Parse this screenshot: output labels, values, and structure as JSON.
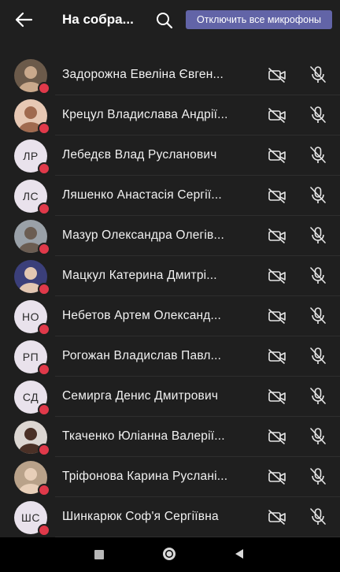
{
  "header": {
    "title": "На собра...",
    "mute_all_label": "Отключить все микрофоны"
  },
  "participants": [
    {
      "name": "",
      "initials": "",
      "avatar": "photo-partial"
    },
    {
      "name": "Задорожна Евеліна Євген...",
      "initials": "",
      "avatar": "photo"
    },
    {
      "name": "Крецул Владислава Андрії...",
      "initials": "",
      "avatar": "photo"
    },
    {
      "name": "Лебедєв Влад Русланович",
      "initials": "ЛР",
      "avatar": "initials"
    },
    {
      "name": "Ляшенко Анастасія Сергії...",
      "initials": "ЛС",
      "avatar": "initials"
    },
    {
      "name": "Мазур Олександра Олегів...",
      "initials": "",
      "avatar": "photo"
    },
    {
      "name": "Мацкул Катерина Дмитрі...",
      "initials": "",
      "avatar": "photo"
    },
    {
      "name": "Небетов Артем Олександ...",
      "initials": "НО",
      "avatar": "initials"
    },
    {
      "name": "Рогожан Владислав Павл...",
      "initials": "РП",
      "avatar": "initials"
    },
    {
      "name": "Семирга Денис Дмитрович",
      "initials": "СД",
      "avatar": "initials"
    },
    {
      "name": "Ткаченко Юліанна Валерії...",
      "initials": "",
      "avatar": "photo"
    },
    {
      "name": "Тріфонова Карина Руслані...",
      "initials": "",
      "avatar": "photo"
    },
    {
      "name": "Шинкарюк Соф'я Сергіївна",
      "initials": "ШС",
      "avatar": "initials"
    }
  ],
  "colors": {
    "accent": "#6264a7",
    "background": "#1f1f1f",
    "status_dot": "#e0394a"
  },
  "icons": {
    "back": "arrow-left-icon",
    "search": "search-icon",
    "camera": "camera-off-icon",
    "mic": "mic-off-icon"
  }
}
